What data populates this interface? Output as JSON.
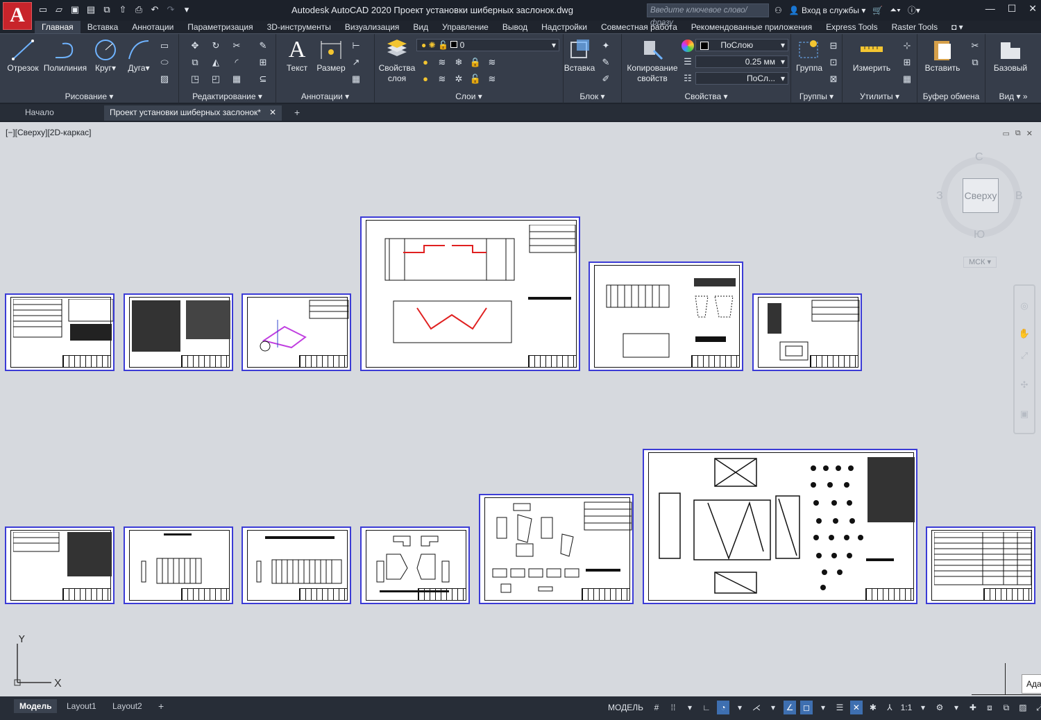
{
  "app": {
    "title": "Autodesk AutoCAD 2020   Проект установки шиберных заслонок.dwg",
    "logo": "A",
    "search_placeholder": "Введите ключевое слово/фразу",
    "signin": "Вход в службы"
  },
  "ribbon_tabs": [
    "Главная",
    "Вставка",
    "Аннотации",
    "Параметризация",
    "3D-инструменты",
    "Визуализация",
    "Вид",
    "Управление",
    "Вывод",
    "Надстройки",
    "Совместная работа",
    "Рекомендованные приложения",
    "Express Tools",
    "Raster Tools"
  ],
  "panels": {
    "draw": {
      "title": "Рисование",
      "line": "Отрезок",
      "polyline": "Полилиния",
      "circle": "Круг",
      "arc": "Дуга"
    },
    "modify": {
      "title": "Редактирование"
    },
    "annotation": {
      "title": "Аннотации",
      "text": "Текст",
      "dimension": "Размер"
    },
    "layers": {
      "title": "Слои",
      "layer_props": "Свойства слоя",
      "current_layer": "0"
    },
    "block": {
      "title": "Блок",
      "insert": "Вставка"
    },
    "properties": {
      "title": "Свойства",
      "match": "Копирование свойств",
      "color": "ПоСлою",
      "lineweight": "0.25 мм",
      "linetype": "ПоСл..."
    },
    "groups": {
      "title": "Группы",
      "group": "Группа"
    },
    "utilities": {
      "title": "Утилиты",
      "measure": "Измерить"
    },
    "clipboard": {
      "title": "Буфер обмена",
      "paste": "Вставить"
    },
    "view": {
      "title": "Вид",
      "base": "Базовый"
    }
  },
  "doc_tabs": {
    "start": "Начало",
    "current": "Проект установки шиберных заслонок*"
  },
  "viewport": {
    "label": "[−][Сверху][2D-каркас]"
  },
  "viewcube": {
    "face": "Сверху",
    "n": "С",
    "s": "Ю",
    "w": "З",
    "e": "В",
    "wcs": "МСК"
  },
  "ucs": {
    "x": "X",
    "y": "Y"
  },
  "layout_tabs": [
    "Модель",
    "Layout1",
    "Layout2"
  ],
  "status": {
    "model": "МОДЕЛЬ",
    "scale": "1:1"
  },
  "tooltip": "Ада"
}
